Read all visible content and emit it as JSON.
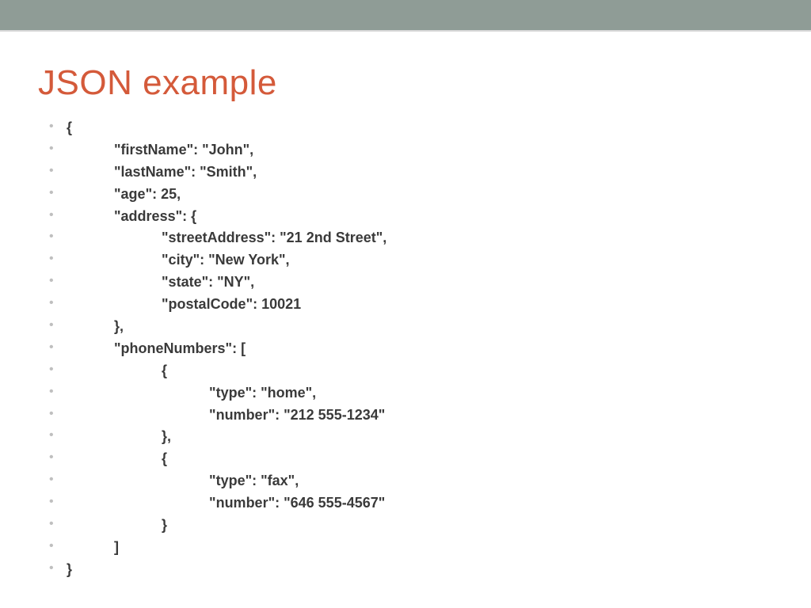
{
  "title": "JSON example",
  "lines": [
    "{",
    "            \"firstName\": \"John\",",
    "            \"lastName\": \"Smith\",",
    "            \"age\": 25,",
    "            \"address\": {",
    "                        \"streetAddress\": \"21 2nd Street\",",
    "                        \"city\": \"New York\",",
    "                        \"state\": \"NY\",",
    "                        \"postalCode\": 10021",
    "            },",
    "            \"phoneNumbers\": [",
    "                        {",
    "                                    \"type\": \"home\",",
    "                                    \"number\": \"212 555-1234\"",
    "                        },",
    "                        {",
    "                                    \"type\": \"fax\",",
    "                                    \"number\": \"646 555-4567\"",
    "                        }",
    "            ]",
    "}"
  ]
}
